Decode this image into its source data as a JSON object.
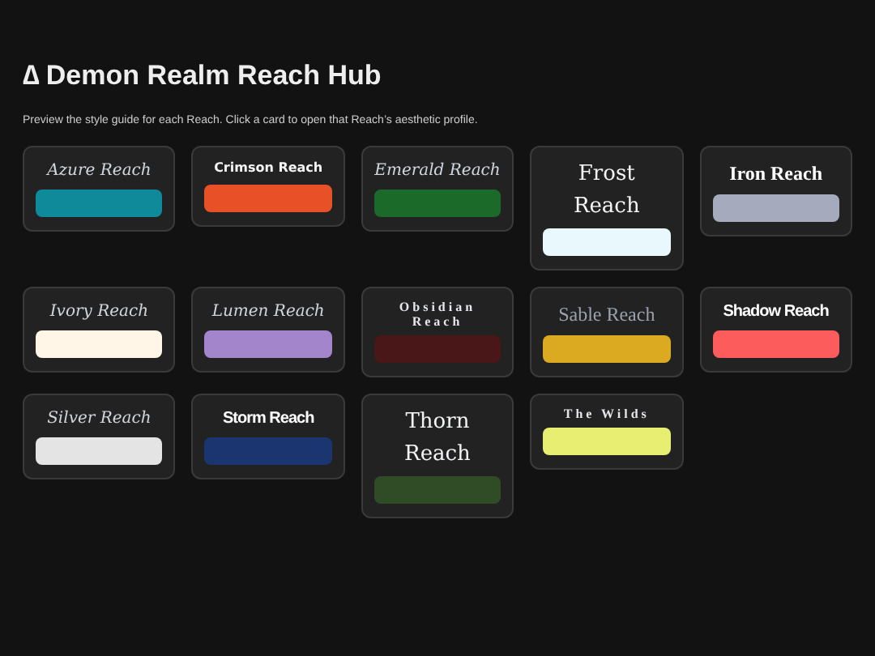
{
  "header": {
    "icon": "∆",
    "title": "Demon Realm Reach Hub",
    "subtitle": "Preview the style guide for each Reach. Click a card to open that Reach’s aesthetic profile."
  },
  "cards": [
    {
      "name": "Azure Reach",
      "kind": "script",
      "color": "#0e8a9a"
    },
    {
      "name": "Crimson Reach",
      "kind": "sans",
      "color": "#e85128"
    },
    {
      "name": "Emerald Reach",
      "kind": "script",
      "color": "#1b6a2a"
    },
    {
      "name": "Frost Reach",
      "kind": "serif",
      "color": "#e8f8fc"
    },
    {
      "name": "Iron Reach",
      "kind": "caps",
      "color": "#a5aabd"
    },
    {
      "name": "Ivory Reach",
      "kind": "script",
      "color": "#fff6e8"
    },
    {
      "name": "Lumen Reach",
      "kind": "script",
      "color": "#a385cc"
    },
    {
      "name": "Obsidian Reach",
      "kind": "wide",
      "color": "#4a1719"
    },
    {
      "name": "Sable Reach",
      "kind": "thin",
      "color": "#dcaa20"
    },
    {
      "name": "Shadow Reach",
      "kind": "condensed",
      "color": "#fd5c5d"
    },
    {
      "name": "Silver Reach",
      "kind": "script",
      "color": "#e4e4e4"
    },
    {
      "name": "Storm Reach",
      "kind": "condensed",
      "color": "#1b3570"
    },
    {
      "name": "Thorn Reach",
      "kind": "serif",
      "color": "#2f4c26"
    },
    {
      "name": "The Wilds",
      "kind": "wide",
      "color": "#e8ee72"
    }
  ]
}
